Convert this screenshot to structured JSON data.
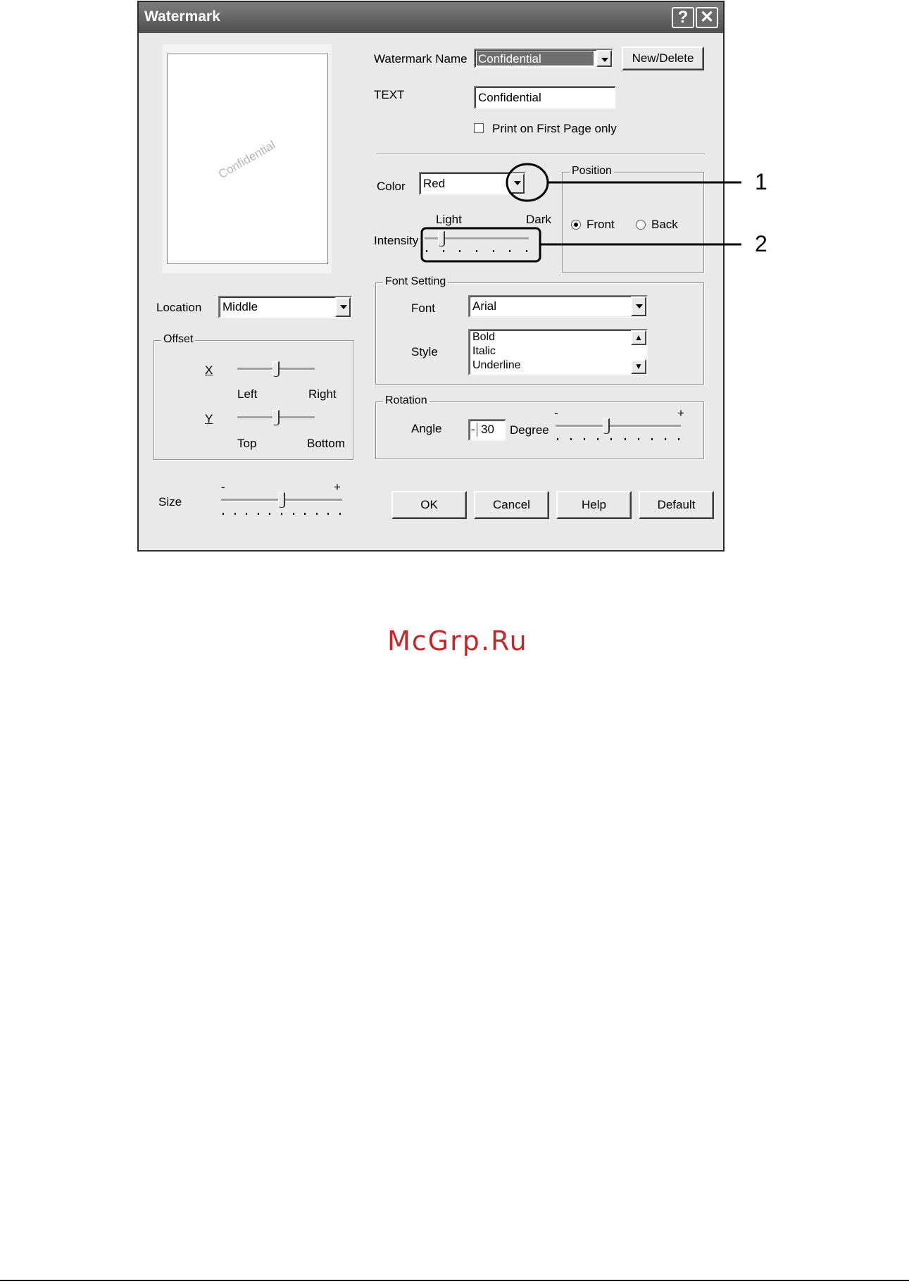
{
  "dialog": {
    "title": "Watermark",
    "help_glyph": "?",
    "close_glyph": "✕"
  },
  "preview": {
    "watermark_text": "Confidential"
  },
  "watermark_name": {
    "label": "Watermark Name",
    "value": "Confidential",
    "new_delete_label": "New/Delete"
  },
  "text_field": {
    "label": "TEXT",
    "value": "Confidential"
  },
  "first_page_only": {
    "label": "Print on First Page only",
    "checked": false
  },
  "color": {
    "label": "Color",
    "value": "Red"
  },
  "intensity": {
    "label": "Intensity",
    "light_label": "Light",
    "dark_label": "Dark",
    "level": 0.15
  },
  "position": {
    "legend": "Position",
    "options": [
      "Front",
      "Back"
    ],
    "selected": "Front"
  },
  "location": {
    "label": "Location",
    "value": "Middle"
  },
  "offset": {
    "legend": "Offset",
    "x_label": "X",
    "x_left": "Left",
    "x_right": "Right",
    "x_level": 0.5,
    "y_label": "Y",
    "y_top": "Top",
    "y_bottom": "Bottom",
    "y_level": 0.5
  },
  "font_setting": {
    "legend": "Font Setting",
    "font_label": "Font",
    "font_value": "Arial",
    "style_label": "Style",
    "styles": [
      "Bold",
      "Italic",
      "Underline"
    ]
  },
  "rotation": {
    "legend": "Rotation",
    "angle_label": "Angle",
    "angle_sign": "-",
    "angle_value": "30",
    "degree_label": "Degree",
    "minus": "-",
    "plus": "+",
    "level": 0.4
  },
  "size": {
    "label": "Size",
    "minus": "-",
    "plus": "+",
    "level": 0.5
  },
  "buttons": {
    "ok": "OK",
    "cancel": "Cancel",
    "help": "Help",
    "default": "Default"
  },
  "callouts": [
    "1",
    "2"
  ],
  "footer": {
    "site": "McGrp.Ru"
  }
}
